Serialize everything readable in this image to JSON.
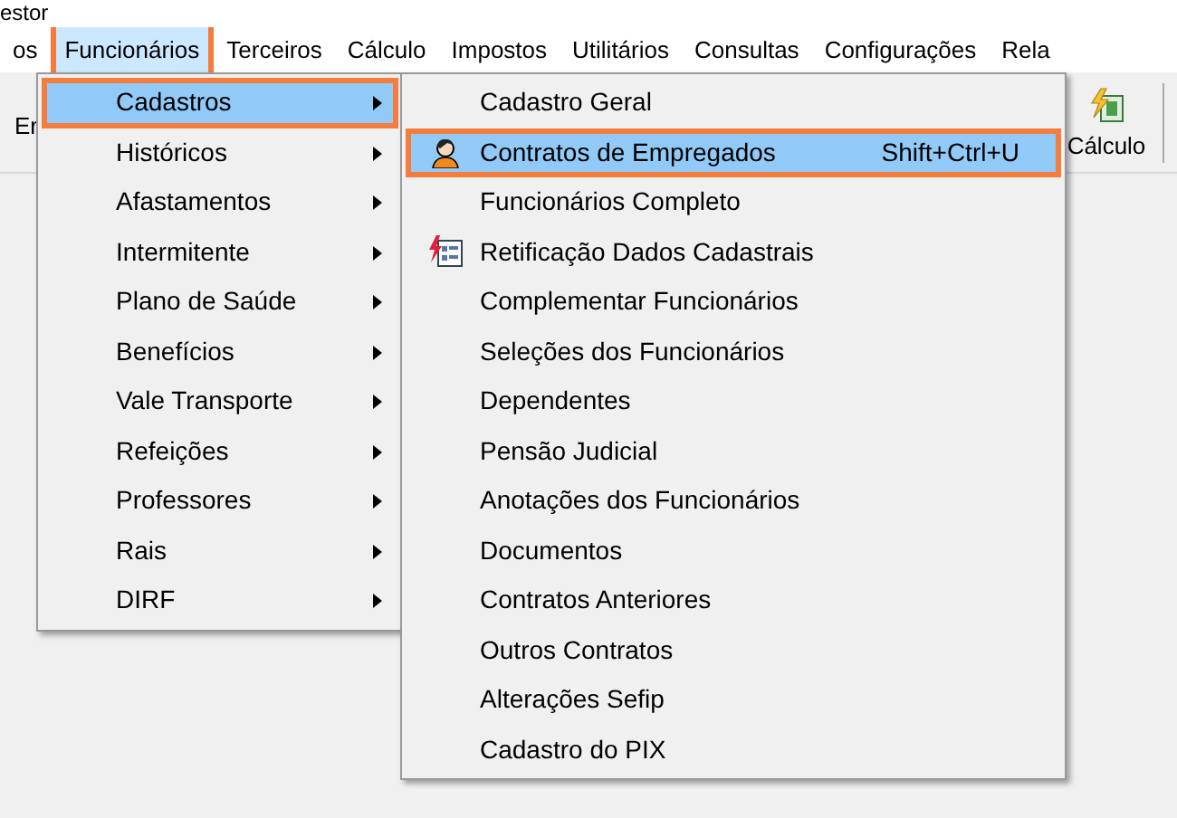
{
  "window": {
    "title": "estor"
  },
  "menu_bar": [
    {
      "label": "os",
      "selected": false,
      "annotated": false
    },
    {
      "label": "Funcionários",
      "selected": true,
      "annotated": true
    },
    {
      "label": "Terceiros",
      "selected": false,
      "annotated": false
    },
    {
      "label": "Cálculo",
      "selected": false,
      "annotated": false
    },
    {
      "label": "Impostos",
      "selected": false,
      "annotated": false
    },
    {
      "label": "Utilitários",
      "selected": false,
      "annotated": false
    },
    {
      "label": "Consultas",
      "selected": false,
      "annotated": false
    },
    {
      "label": "Configurações",
      "selected": false,
      "annotated": false
    },
    {
      "label": "Rela",
      "selected": false,
      "annotated": false
    }
  ],
  "toolbar": {
    "left_label": "Er",
    "buttons": [
      {
        "label": "Cálculo"
      }
    ]
  },
  "menu": [
    {
      "label": "Cadastros",
      "selected": true,
      "annotated": true
    },
    {
      "label": "Históricos",
      "selected": false,
      "annotated": false
    },
    {
      "label": "Afastamentos",
      "selected": false,
      "annotated": false
    },
    {
      "label": "Intermitente",
      "selected": false,
      "annotated": false
    },
    {
      "label": "Plano de Saúde",
      "selected": false,
      "annotated": false
    },
    {
      "label": "Benefícios",
      "selected": false,
      "annotated": false
    },
    {
      "label": "Vale Transporte",
      "selected": false,
      "annotated": false
    },
    {
      "label": "Refeições",
      "selected": false,
      "annotated": false
    },
    {
      "label": "Professores",
      "selected": false,
      "annotated": false
    },
    {
      "label": "Rais",
      "selected": false,
      "annotated": false
    },
    {
      "label": "DIRF",
      "selected": false,
      "annotated": false
    }
  ],
  "submenu": [
    {
      "label": "Cadastro Geral",
      "selected": false,
      "annotated": false
    },
    {
      "label": "Contratos de Empregados",
      "shortcut": "Shift+Ctrl+U",
      "kind": "person",
      "selected": true,
      "annotated": true
    },
    {
      "label": "Funcionários Completo",
      "selected": false,
      "annotated": false
    },
    {
      "label": "Retificação Dados Cadastrais",
      "kind": "form",
      "selected": false,
      "annotated": false
    },
    {
      "label": "Complementar Funcionários",
      "selected": false,
      "annotated": false
    },
    {
      "label": "Seleções dos Funcionários",
      "selected": false,
      "annotated": false
    },
    {
      "label": "Dependentes",
      "selected": false,
      "annotated": false
    },
    {
      "label": "Pensão Judicial",
      "selected": false,
      "annotated": false
    },
    {
      "label": "Anotações dos Funcionários",
      "selected": false,
      "annotated": false
    },
    {
      "label": "Documentos",
      "selected": false,
      "annotated": false
    },
    {
      "label": "Contratos Anteriores",
      "selected": false,
      "annotated": false
    },
    {
      "label": "Outros Contratos",
      "selected": false,
      "annotated": false
    },
    {
      "label": "Alterações Sefip",
      "selected": false,
      "annotated": false
    },
    {
      "label": "Cadastro do PIX",
      "selected": false,
      "annotated": false
    }
  ]
}
